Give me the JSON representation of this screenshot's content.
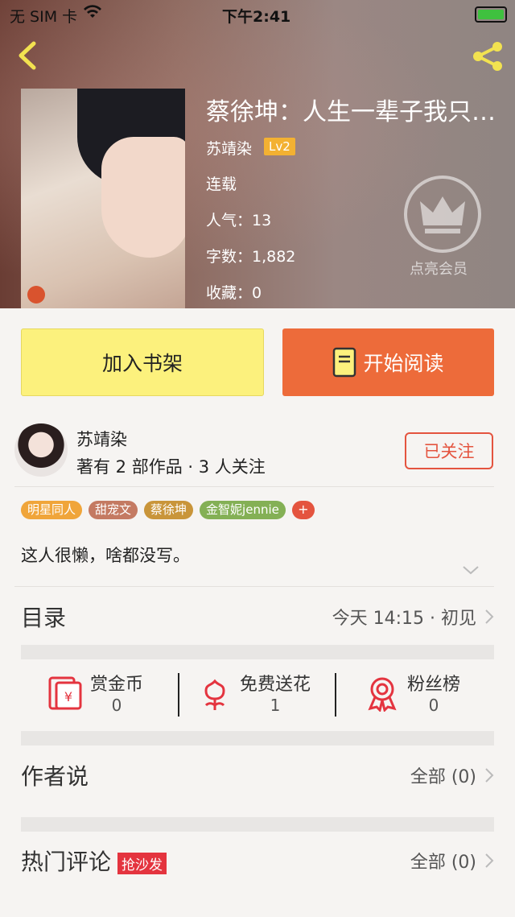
{
  "status_bar": {
    "carrier": "无 SIM 卡",
    "time": "下午2:41"
  },
  "book": {
    "title": "蔡徐坤：人生一辈子我只…",
    "author": "苏靖染",
    "level": "Lv2",
    "status": "连载",
    "popularity": "人气：13",
    "word_count": "字数：1,882",
    "favorites": "收藏：0"
  },
  "vip": {
    "label": "点亮会员"
  },
  "actions": {
    "add_shelf": "加入书架",
    "start_read": "开始阅读"
  },
  "author_card": {
    "name": "苏靖染",
    "stats": "著有 2 部作品 · 3 人关注",
    "follow_label": "已关注"
  },
  "tags": [
    {
      "label": "明星同人",
      "color": "#f0a53a"
    },
    {
      "label": "甜宠文",
      "color": "#c47a62"
    },
    {
      "label": "蔡徐坤",
      "color": "#c9953a"
    },
    {
      "label": "金智妮jennie",
      "color": "#84b055"
    }
  ],
  "tag_more": "+",
  "description": "这人很懒，啥都没写。",
  "catalog": {
    "label": "目录",
    "value": "今天 14:15 · 初见"
  },
  "stats": [
    {
      "label": "赏金币",
      "value": "0",
      "icon": "red-envelope-icon"
    },
    {
      "label": "免费送花",
      "value": "1",
      "icon": "flower-icon"
    },
    {
      "label": "粉丝榜",
      "value": "0",
      "icon": "medal-icon"
    }
  ],
  "author_says": {
    "label": "作者说",
    "value": "全部 (0)"
  },
  "hot_comments": {
    "label": "热门评论",
    "badge": "抢沙发",
    "value": "全部 (0)"
  }
}
